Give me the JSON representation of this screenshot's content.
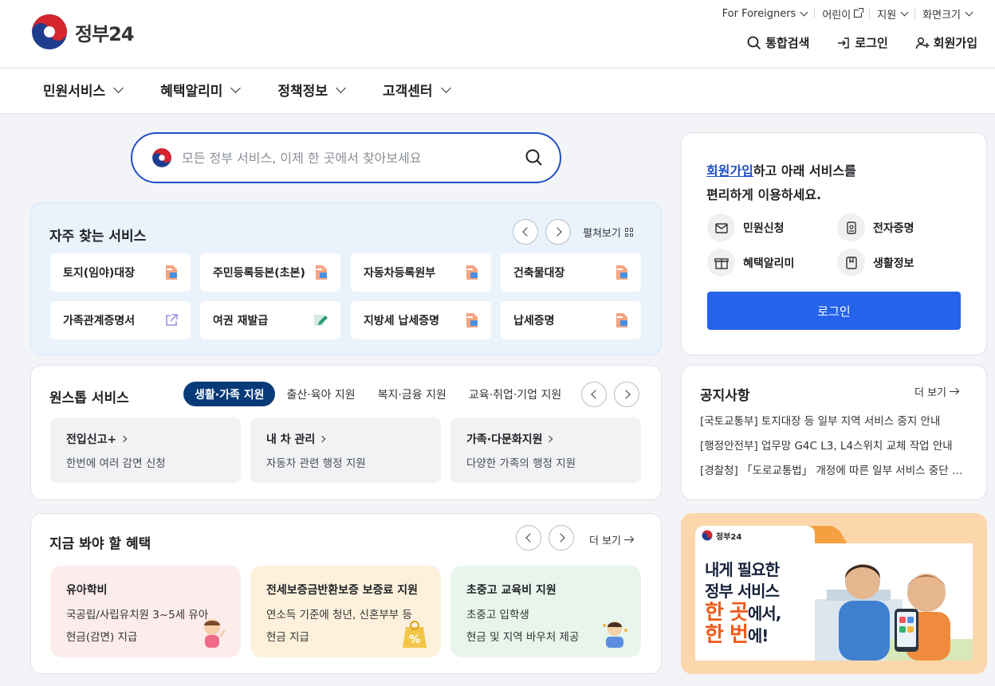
{
  "header": {
    "logo_text": "정부24",
    "utility": [
      {
        "label": "For Foreigners"
      },
      {
        "label": "어린이"
      },
      {
        "label": "지원"
      },
      {
        "label": "화면크기"
      }
    ],
    "actions": {
      "search": "통합검색",
      "login": "로그인",
      "signup": "회원가입"
    },
    "gnb": [
      "민원서비스",
      "혜택알리미",
      "정책정보",
      "고객센터"
    ]
  },
  "search": {
    "placeholder": "모든 정부 서비스, 이제 한 곳에서 찾아보세요"
  },
  "frequent": {
    "title": "자주 찾는 서비스",
    "spread_label": "펼쳐보기",
    "items": [
      {
        "label": "토지(임야)대장",
        "icon": "pdf-doc-icon"
      },
      {
        "label": "주민등록등본(초본)",
        "icon": "pdf-doc-icon"
      },
      {
        "label": "자동차등록원부",
        "icon": "pdf-doc-icon"
      },
      {
        "label": "건축물대장",
        "icon": "pdf-doc-icon"
      },
      {
        "label": "가족관계증명서",
        "icon": "external-link-icon"
      },
      {
        "label": "여권 재발급",
        "icon": "edit-doc-icon"
      },
      {
        "label": "지방세 납세증명",
        "icon": "pdf-doc-icon"
      },
      {
        "label": "납세증명",
        "icon": "pdf-doc-icon"
      }
    ]
  },
  "onestop": {
    "title": "원스톱 서비스",
    "tabs": [
      "생활·가족 지원",
      "출산·육아 지원",
      "복지·금융 지원",
      "교육·취업·기업 지원"
    ],
    "cards": [
      {
        "title": "전입신고+",
        "desc": "한번에 여러 감면 신청"
      },
      {
        "title": "내 차 관리",
        "desc": "자동차 관련 행정 지원"
      },
      {
        "title": "가족·다문화지원",
        "desc": "다양한 가족의 행정 지원"
      }
    ]
  },
  "benefits": {
    "title": "지금 봐야 할 혜택",
    "more_label": "더 보기",
    "cards": [
      {
        "title": "유아학비",
        "line1": "국공립/사립유치원 3~5세 유아",
        "line2": "현금(감면) 지급",
        "bg": "#fdecec"
      },
      {
        "title": "전세보증금반환보증 보증료 지원",
        "line1": "연소득 기준에 청년, 신혼부부 등",
        "line2": "현금 지급",
        "bg": "#fdf1dc"
      },
      {
        "title": "초중고 교육비 지원",
        "line1": "초중고 입학생",
        "line2": "현금 및 지역 바우처 제공",
        "bg": "#e7f5ec"
      }
    ]
  },
  "signup_panel": {
    "accent": "회원가입",
    "text1": "하고 아래 서비스를",
    "text2": "편리하게 이용하세요.",
    "items": [
      "민원신청",
      "전자증명",
      "혜택알리미",
      "생활정보"
    ],
    "login_label": "로그인"
  },
  "notice": {
    "title": "공지사항",
    "more_label": "더 보기",
    "items": [
      "[국토교통부] 토지대장 등 일부 지역 서비스 중지 안내",
      "[행정안전부] 업무망 G4C L3, L4스위치 교체 작업 안내",
      "[경찰청] 「도로교통법」 개정에 따른 일부 서비스 중단 안내"
    ]
  },
  "banner": {
    "logo_text": "정부24",
    "line1": "내게 필요한",
    "line2": "정부 서비스",
    "hl1": "한 곳",
    "suffix1": "에서,",
    "hl2": "한 번",
    "suffix2": "에!"
  },
  "colors": {
    "primary": "#1f4ec8",
    "navy": "#073a78",
    "button": "#2563eb",
    "banner": "#fbd7ab"
  }
}
